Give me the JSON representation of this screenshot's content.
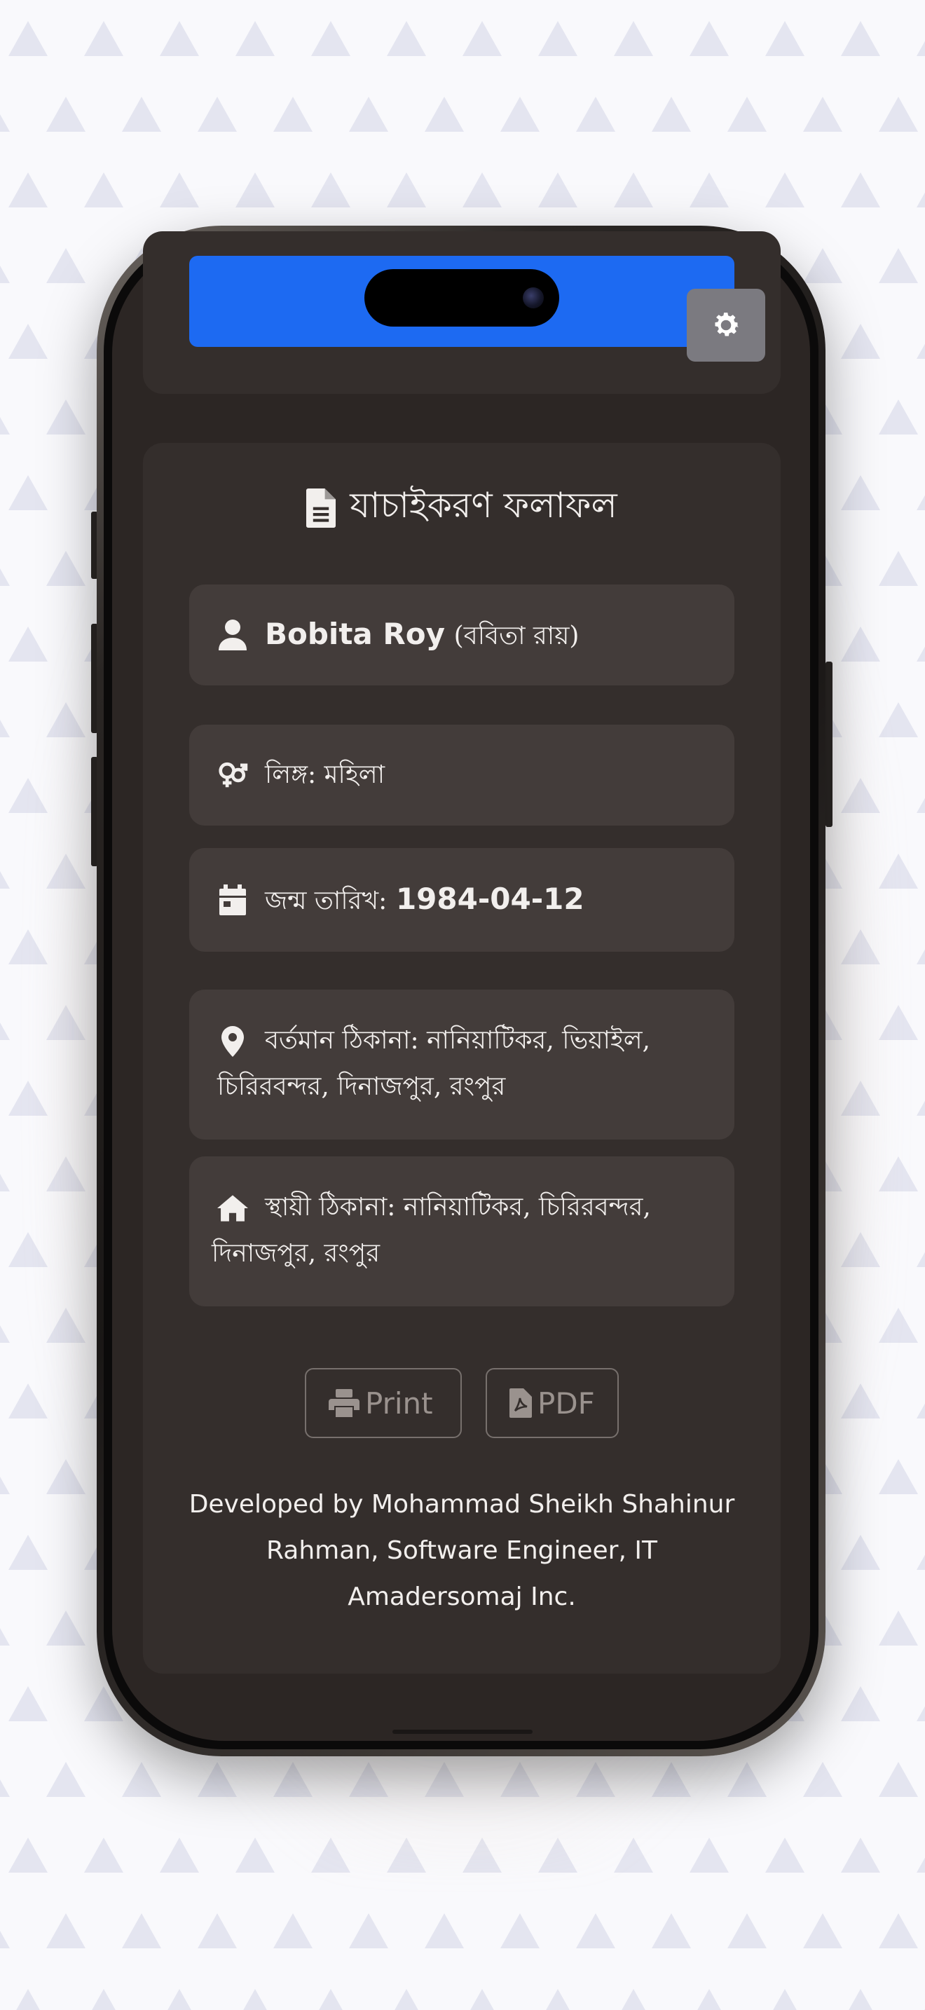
{
  "colors": {
    "accent_blue": "#1d6af2",
    "card_bg": "#342e2c",
    "field_bg": "#433c3a",
    "screen_bg": "#2c2624",
    "text": "#f2efed",
    "button_outline": "#77706d"
  },
  "header": {
    "settings_icon": "gear-icon"
  },
  "result": {
    "title": "যাচাইকরণ ফলাফল",
    "title_icon": "document-icon",
    "name": {
      "icon": "user-icon",
      "english": "Bobita Roy",
      "bangla": "(ববিতা রায়)"
    },
    "gender": {
      "icon": "gender-icon",
      "text": "লিঙ্গ: মহিলা"
    },
    "birth_date": {
      "icon": "calendar-icon",
      "label": "জন্ম তারিখ:",
      "value": "1984-04-12"
    },
    "present_address": {
      "icon": "location-pin-icon",
      "line1": "বর্তমান ঠিকানা: নানিয়াটিকর, ভিয়াইল,",
      "line2": "চিরিরবন্দর, দিনাজপুর, রংপুর"
    },
    "permanent_address": {
      "icon": "home-icon",
      "line1": "স্থায়ী ঠিকানা: নানিয়াটিকর, চিরিরবন্দর,",
      "line2": "দিনাজপুর, রংপুর"
    }
  },
  "actions": {
    "print_label": "Print",
    "print_icon": "printer-icon",
    "pdf_label": "PDF",
    "pdf_icon": "pdf-file-icon"
  },
  "footer": {
    "line1": "Developed by Mohammad Sheikh Shahinur",
    "line2": "Rahman, Software Engineer, IT",
    "line3": "Amadersomaj Inc."
  }
}
